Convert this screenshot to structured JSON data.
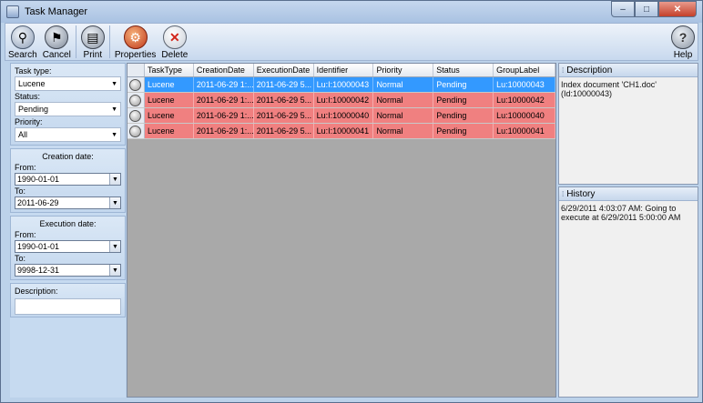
{
  "window": {
    "title": "Task Manager",
    "minimize": "–",
    "maximize": "□",
    "close": "✕"
  },
  "toolbar": {
    "search": "Search",
    "cancel": "Cancel",
    "print": "Print",
    "properties": "Properties",
    "delete": "Delete",
    "help": "Help"
  },
  "filters": {
    "task_type_label": "Task type:",
    "task_type_value": "Lucene",
    "status_label": "Status:",
    "status_value": "Pending",
    "priority_label": "Priority:",
    "priority_value": "All",
    "creation_header": "Creation date:",
    "creation_from_label": "From:",
    "creation_from_value": "1990-01-01",
    "creation_to_label": "To:",
    "creation_to_value": "2011-06-29",
    "execution_header": "Execution date:",
    "execution_from_label": "From:",
    "execution_from_value": "1990-01-01",
    "execution_to_label": "To:",
    "execution_to_value": "9998-12-31",
    "description_label": "Description:",
    "description_value": ""
  },
  "grid": {
    "columns": [
      "TaskType",
      "CreationDate",
      "ExecutionDate",
      "Identifier",
      "Priority",
      "Status",
      "GroupLabel"
    ],
    "rows": [
      {
        "task_type": "Lucene",
        "creation": "2011-06-29 1:...",
        "execution": "2011-06-29 5...",
        "identifier": "Lu:I:10000043",
        "priority": "Normal",
        "status": "Pending",
        "group": "Lu:10000043"
      },
      {
        "task_type": "Lucene",
        "creation": "2011-06-29 1:...",
        "execution": "2011-06-29 5...",
        "identifier": "Lu:I:10000042",
        "priority": "Normal",
        "status": "Pending",
        "group": "Lu:10000042"
      },
      {
        "task_type": "Lucene",
        "creation": "2011-06-29 1:...",
        "execution": "2011-06-29 5...",
        "identifier": "Lu:I:10000040",
        "priority": "Normal",
        "status": "Pending",
        "group": "Lu:10000040"
      },
      {
        "task_type": "Lucene",
        "creation": "2011-06-29 1:...",
        "execution": "2011-06-29 5...",
        "identifier": "Lu:I:10000041",
        "priority": "Normal",
        "status": "Pending",
        "group": "Lu:10000041"
      }
    ],
    "selected_color": "#3399ff",
    "pending_color": "#f08080"
  },
  "description_panel": {
    "title": "Description",
    "text_line1": "Index document 'CH1.doc'",
    "text_line2": "(Id:10000043)"
  },
  "history_panel": {
    "title": "History",
    "text": "6/29/2011 4:03:07 AM: Going to execute at 6/29/2011 5:00:00 AM"
  },
  "icons": {
    "search": "magnifier-icon",
    "cancel": "cancel-icon",
    "print": "printer-icon",
    "properties": "gear-icon",
    "delete": "delete-icon",
    "help": "help-icon"
  }
}
